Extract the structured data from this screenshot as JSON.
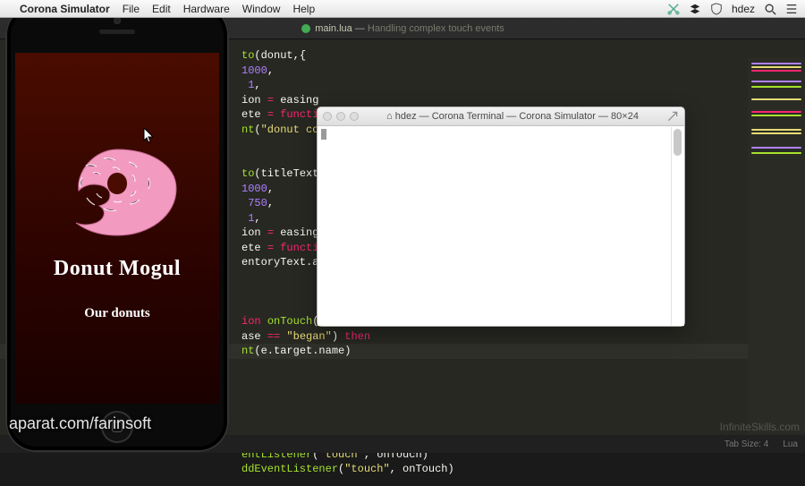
{
  "menubar": {
    "app_title": "Corona Simulator",
    "items": [
      "File",
      "Edit",
      "Hardware",
      "Window",
      "Help"
    ],
    "user": "hdez"
  },
  "editor": {
    "filename": "main.lua",
    "subtitle": "Handling complex touch events",
    "code_lines": [
      {
        "segments": [
          {
            "t": "to",
            "c": "tk-func"
          },
          {
            "t": "(donut,{",
            "c": "tk-default"
          }
        ]
      },
      {
        "segments": [
          {
            "t": "1000",
            "c": "tk-number"
          },
          {
            "t": ",",
            "c": "tk-default"
          }
        ]
      },
      {
        "segments": [
          {
            "t": " 1",
            "c": "tk-number"
          },
          {
            "t": ",",
            "c": "tk-default"
          }
        ]
      },
      {
        "segments": [
          {
            "t": "ion ",
            "c": "tk-ident"
          },
          {
            "t": "=",
            "c": "tk-op"
          },
          {
            "t": " easing",
            "c": "tk-ident"
          }
        ]
      },
      {
        "segments": [
          {
            "t": "ete ",
            "c": "tk-ident"
          },
          {
            "t": "=",
            "c": "tk-op"
          },
          {
            "t": " ",
            "c": "tk-default"
          },
          {
            "t": "functi",
            "c": "tk-keyword"
          }
        ]
      },
      {
        "segments": [
          {
            "t": "nt",
            "c": "tk-func"
          },
          {
            "t": "(",
            "c": "tk-paren"
          },
          {
            "t": "\"donut co",
            "c": "tk-string"
          }
        ]
      },
      {
        "segments": [
          {
            "t": "",
            "c": "tk-default"
          }
        ]
      },
      {
        "segments": [
          {
            "t": "",
            "c": "tk-default"
          }
        ]
      },
      {
        "segments": [
          {
            "t": "to",
            "c": "tk-func"
          },
          {
            "t": "(titleText",
            "c": "tk-default"
          }
        ]
      },
      {
        "segments": [
          {
            "t": "1000",
            "c": "tk-number"
          },
          {
            "t": ",",
            "c": "tk-default"
          }
        ]
      },
      {
        "segments": [
          {
            "t": " 750",
            "c": "tk-number"
          },
          {
            "t": ",",
            "c": "tk-default"
          }
        ]
      },
      {
        "segments": [
          {
            "t": " 1",
            "c": "tk-number"
          },
          {
            "t": ",",
            "c": "tk-default"
          }
        ]
      },
      {
        "segments": [
          {
            "t": "ion ",
            "c": "tk-ident"
          },
          {
            "t": "=",
            "c": "tk-op"
          },
          {
            "t": " easing",
            "c": "tk-ident"
          }
        ]
      },
      {
        "segments": [
          {
            "t": "ete ",
            "c": "tk-ident"
          },
          {
            "t": "=",
            "c": "tk-op"
          },
          {
            "t": " ",
            "c": "tk-default"
          },
          {
            "t": "functi",
            "c": "tk-keyword"
          }
        ]
      },
      {
        "segments": [
          {
            "t": "entoryText.a",
            "c": "tk-ident"
          }
        ]
      },
      {
        "segments": [
          {
            "t": "",
            "c": "tk-default"
          }
        ]
      },
      {
        "segments": [
          {
            "t": "",
            "c": "tk-default"
          }
        ]
      },
      {
        "segments": [
          {
            "t": "",
            "c": "tk-default"
          }
        ]
      },
      {
        "segments": [
          {
            "t": "ion",
            "c": "tk-keyword"
          },
          {
            "t": " ",
            "c": "tk-default"
          },
          {
            "t": "onTouch",
            "c": "tk-func"
          },
          {
            "t": "(",
            "c": "tk-paren"
          }
        ]
      },
      {
        "segments": [
          {
            "t": "ase ",
            "c": "tk-ident"
          },
          {
            "t": "==",
            "c": "tk-op"
          },
          {
            "t": " ",
            "c": "tk-default"
          },
          {
            "t": "\"began\"",
            "c": "tk-string"
          },
          {
            "t": ") ",
            "c": "tk-paren"
          },
          {
            "t": "then",
            "c": "tk-keyword"
          }
        ]
      },
      {
        "segments": [
          {
            "t": "nt",
            "c": "tk-func"
          },
          {
            "t": "(e.target.name)",
            "c": "tk-default"
          }
        ],
        "hl": true
      },
      {
        "segments": [
          {
            "t": "",
            "c": "tk-default"
          }
        ]
      },
      {
        "segments": [
          {
            "t": "",
            "c": "tk-default"
          }
        ]
      },
      {
        "segments": [
          {
            "t": "",
            "c": "tk-default"
          }
        ]
      },
      {
        "segments": [
          {
            "t": "",
            "c": "tk-default"
          }
        ]
      },
      {
        "segments": [
          {
            "t": "",
            "c": "tk-default"
          }
        ]
      },
      {
        "segments": [
          {
            "t": "",
            "c": "tk-default"
          }
        ]
      },
      {
        "segments": [
          {
            "t": "entListener",
            "c": "tk-func"
          },
          {
            "t": "(",
            "c": "tk-paren"
          },
          {
            "t": "\"touch\"",
            "c": "tk-string"
          },
          {
            "t": ", onTouch)",
            "c": "tk-default"
          }
        ]
      },
      {
        "segments": [
          {
            "t": "ddEventListener",
            "c": "tk-func"
          },
          {
            "t": "(",
            "c": "tk-paren"
          },
          {
            "t": "\"touch\"",
            "c": "tk-string"
          },
          {
            "t": ", onTouch)",
            "c": "tk-default"
          }
        ]
      }
    ],
    "status": {
      "tab_size": "Tab Size: 4",
      "lang": "Lua"
    }
  },
  "phone": {
    "title": "Donut Mogul",
    "subtitle": "Our donuts"
  },
  "terminal": {
    "title": "hdez — Corona Terminal — Corona Simulator — 80×24",
    "home_icon": "⌂"
  },
  "watermark": "aparat.com/farinsoft",
  "watermark2": "InfiniteSkills.com"
}
